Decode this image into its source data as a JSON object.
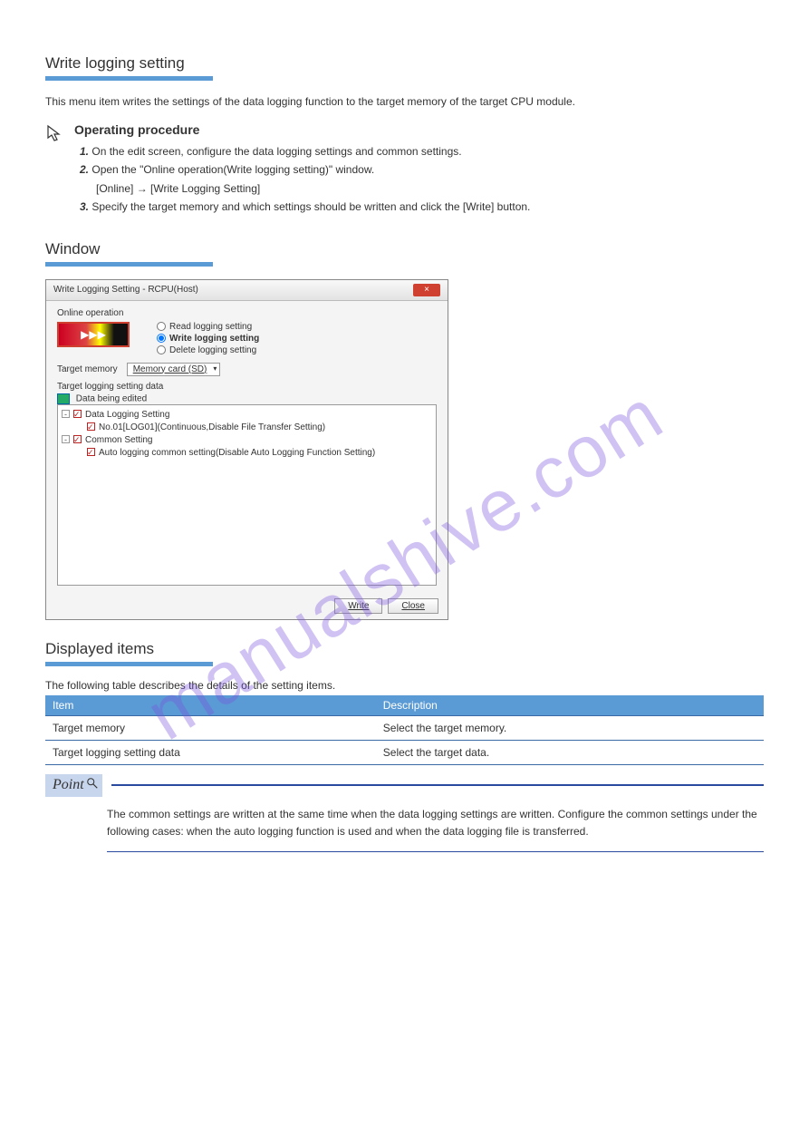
{
  "watermark": "manualshive.com",
  "sec1": {
    "title": "Write logging setting",
    "desc": "This menu item writes the settings of the data logging function to the target memory of the target CPU module.",
    "op_heading": "Operating procedure",
    "steps": [
      "On the edit screen, configure the data logging settings and common settings.",
      "Open the \"Online operation(Write logging setting)\" window.",
      "[Online] → [Write Logging Setting]",
      "Specify the target memory and which settings should be written and click the [Write] button."
    ],
    "step_prefixes": [
      "1.",
      "2.",
      "",
      "3."
    ],
    "nav_icon": "mouse-pointer-icon"
  },
  "sec2": {
    "title": "Window"
  },
  "dialog": {
    "title": "Write Logging Setting - RCPU(Host)",
    "close_label": "×",
    "online_operation_label": "Online operation",
    "radios": {
      "read": "Read logging setting",
      "write": "Write logging setting",
      "delete": "Delete logging setting"
    },
    "target_memory_label": "Target memory",
    "target_memory_value": "Memory card (SD)",
    "target_setting_label": "Target logging setting data",
    "editing_label": "Data being edited",
    "tree": {
      "root1": "Data Logging Setting",
      "child1": "No.01[LOG01](Continuous,Disable File Transfer Setting)",
      "root2": "Common Setting",
      "child2": "Auto logging common setting(Disable Auto Logging Function Setting)"
    },
    "buttons": {
      "write": "Write",
      "close": "Close"
    }
  },
  "sec3": {
    "title": "Displayed items",
    "intro": "The following table describes the details of the setting items.",
    "table": {
      "h1": "Item",
      "h2": "Description",
      "r1c1": "Target memory",
      "r1c2": "Select the target memory.",
      "r2c1": "Target logging setting data",
      "r2c2": "Select the target data."
    }
  },
  "point": {
    "badge": "Point",
    "text": "The common settings are written at the same time when the data logging settings are written. Configure the common settings under the following cases: when the auto logging function is used and when the data logging file is transferred."
  }
}
